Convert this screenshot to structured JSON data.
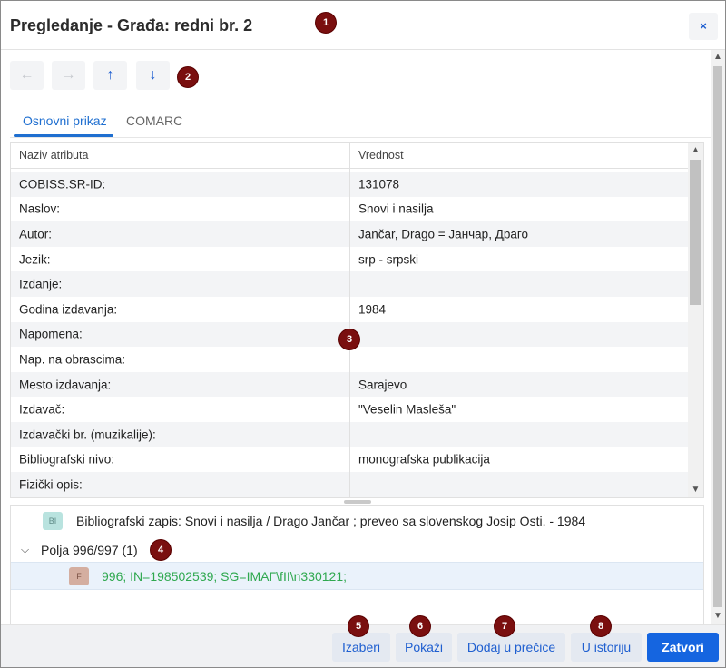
{
  "dialog": {
    "title": "Pregledanje - Građa: redni br. 2",
    "close_icon": "×"
  },
  "toolbar": {
    "back_icon": "←",
    "forward_icon": "→",
    "up_icon": "↑",
    "down_icon": "↓"
  },
  "tabs": [
    {
      "label": "Osnovni prikaz",
      "active": true
    },
    {
      "label": "COMARC",
      "active": false
    }
  ],
  "table": {
    "columns": [
      "Naziv atributa",
      "Vrednost"
    ],
    "rows": [
      {
        "name": "COBISS.SR-ID:",
        "value": "131078"
      },
      {
        "name": "Naslov:",
        "value": "Snovi i nasilja"
      },
      {
        "name": "Autor:",
        "value": "Jančar, Drago = Јанчар, Драго"
      },
      {
        "name": "Jezik:",
        "value": "srp - srpski"
      },
      {
        "name": "Izdanje:",
        "value": ""
      },
      {
        "name": "Godina izdavanja:",
        "value": "1984"
      },
      {
        "name": "Napomena:",
        "value": ""
      },
      {
        "name": "Nap. na obrascima:",
        "value": ""
      },
      {
        "name": "Mesto izdavanja:",
        "value": "Sarajevo"
      },
      {
        "name": "Izdavač:",
        "value": "\"Veselin Masleša\""
      },
      {
        "name": "Izdavački br. (muzikalije):",
        "value": ""
      },
      {
        "name": "Bibliografski nivo:",
        "value": "monografska publikacija"
      },
      {
        "name": "Fizički opis:",
        "value": ""
      }
    ]
  },
  "tree": {
    "bib_badge": "BI",
    "bib_text": "Bibliografski zapis: Snovi i nasilja / Drago Jančar ; preveo sa slovenskog Josip Osti. - 1984",
    "group_label": "Polja 996/997 (1)",
    "item_badge": "F",
    "item_text": "996; IN=198502539; SG=IMAΓ\\fII\\n330121;",
    "item_color": "#2fa84f"
  },
  "footer": {
    "select_label": "Izaberi",
    "show_label": "Pokaži",
    "shortcut_label": "Dodaj u prečice",
    "history_label": "U istoriju",
    "close_label": "Zatvori"
  },
  "markers": [
    "1",
    "2",
    "3",
    "4",
    "5",
    "6",
    "7",
    "8"
  ],
  "colors": {
    "accent": "#1565e0",
    "marker": "#7a0f0f"
  }
}
